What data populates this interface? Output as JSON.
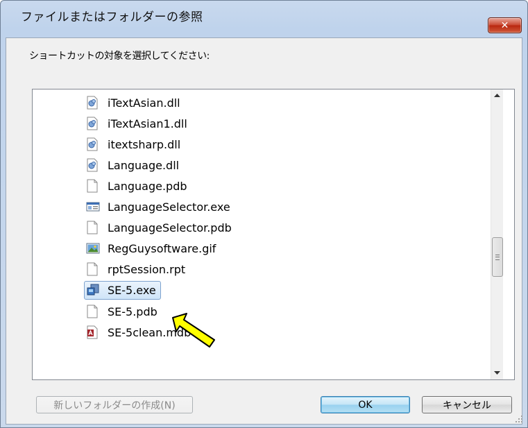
{
  "window": {
    "title": "ファイルまたはフォルダーの参照",
    "close_label": "✕"
  },
  "instruction": "ショートカットの対象を選択してください:",
  "files": [
    {
      "name": "iTextAsian.dll",
      "icon": "dll-icon"
    },
    {
      "name": "iTextAsian1.dll",
      "icon": "dll-icon"
    },
    {
      "name": "itextsharp.dll",
      "icon": "dll-icon"
    },
    {
      "name": "Language.dll",
      "icon": "dll-icon"
    },
    {
      "name": "Language.pdb",
      "icon": "blank-file-icon"
    },
    {
      "name": "LanguageSelector.exe",
      "icon": "exe-window-icon"
    },
    {
      "name": "LanguageSelector.pdb",
      "icon": "blank-file-icon"
    },
    {
      "name": "RegGuysoftware.gif",
      "icon": "image-file-icon"
    },
    {
      "name": "rptSession.rpt",
      "icon": "blank-file-icon"
    },
    {
      "name": "SE-5.exe",
      "icon": "app-icon",
      "selected": true
    },
    {
      "name": "SE-5.pdb",
      "icon": "blank-file-icon"
    },
    {
      "name": "SE-5clean.mdb",
      "icon": "access-db-icon"
    }
  ],
  "buttons": {
    "new_folder": "新しいフォルダーの作成(N)",
    "ok": "OK",
    "cancel": "キャンセル"
  },
  "colors": {
    "pointer_fill": "#ffff00",
    "selection": "#cfe4f8"
  }
}
